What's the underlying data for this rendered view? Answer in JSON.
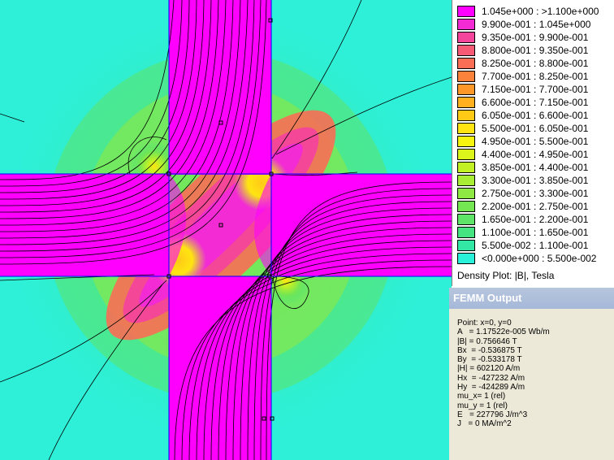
{
  "legend": {
    "entries": [
      {
        "label": "1.045e+000 : >1.100e+000",
        "color": "#ff00ff"
      },
      {
        "label": "9.900e-001 : 1.045e+000",
        "color": "#f22bd4"
      },
      {
        "label": "9.350e-001 : 9.900e-001",
        "color": "#f4449c"
      },
      {
        "label": "8.800e-001 : 9.350e-001",
        "color": "#f75a74"
      },
      {
        "label": "8.250e-001 : 8.800e-001",
        "color": "#f96e55"
      },
      {
        "label": "7.700e-001 : 8.250e-001",
        "color": "#fb823a"
      },
      {
        "label": "7.150e-001 : 7.700e-001",
        "color": "#fd9828"
      },
      {
        "label": "6.600e-001 : 7.150e-001",
        "color": "#ffb01e"
      },
      {
        "label": "6.050e-001 : 6.600e-001",
        "color": "#ffca16"
      },
      {
        "label": "5.500e-001 : 6.050e-001",
        "color": "#ffe412"
      },
      {
        "label": "4.950e-001 : 5.500e-001",
        "color": "#f7f510"
      },
      {
        "label": "4.400e-001 : 4.950e-001",
        "color": "#dcf51a"
      },
      {
        "label": "3.850e-001 : 4.400e-001",
        "color": "#c2f126"
      },
      {
        "label": "3.300e-001 : 3.850e-001",
        "color": "#a8ee34"
      },
      {
        "label": "2.750e-001 : 3.300e-001",
        "color": "#8ee942"
      },
      {
        "label": "2.200e-001 : 2.750e-001",
        "color": "#74e652"
      },
      {
        "label": "1.650e-001 : 2.200e-001",
        "color": "#5ee466"
      },
      {
        "label": "1.100e-001 : 1.650e-001",
        "color": "#46e480"
      },
      {
        "label": "5.500e-002 : 1.100e-001",
        "color": "#33e8a4"
      },
      {
        "label": "<0.000e+000 : 5.500e-002",
        "color": "#29f0d8"
      }
    ],
    "caption": "Density Plot: |B|, Tesla"
  },
  "output": {
    "title": "FEMM Output",
    "lines": [
      "Point: x=0, y=0",
      "A   = 1.17522e-005 Wb/m",
      "|B| = 0.756646 T",
      "Bx  = -0.536875 T",
      "By  = -0.533178 T",
      "|H| = 602120 A/m",
      "Hx  = -427232 A/m",
      "Hy  = -424289 A/m",
      "mu_x= 1 (rel)",
      "mu_y = 1 (rel)",
      "E   = 227796 J/m^3",
      "J   = 0 MA/m^2"
    ]
  },
  "colors": {
    "magenta": "#ff00ff",
    "background_field": "#2ef0d8",
    "window_title": "#a8b9d8",
    "panel": "#ece9d8"
  }
}
